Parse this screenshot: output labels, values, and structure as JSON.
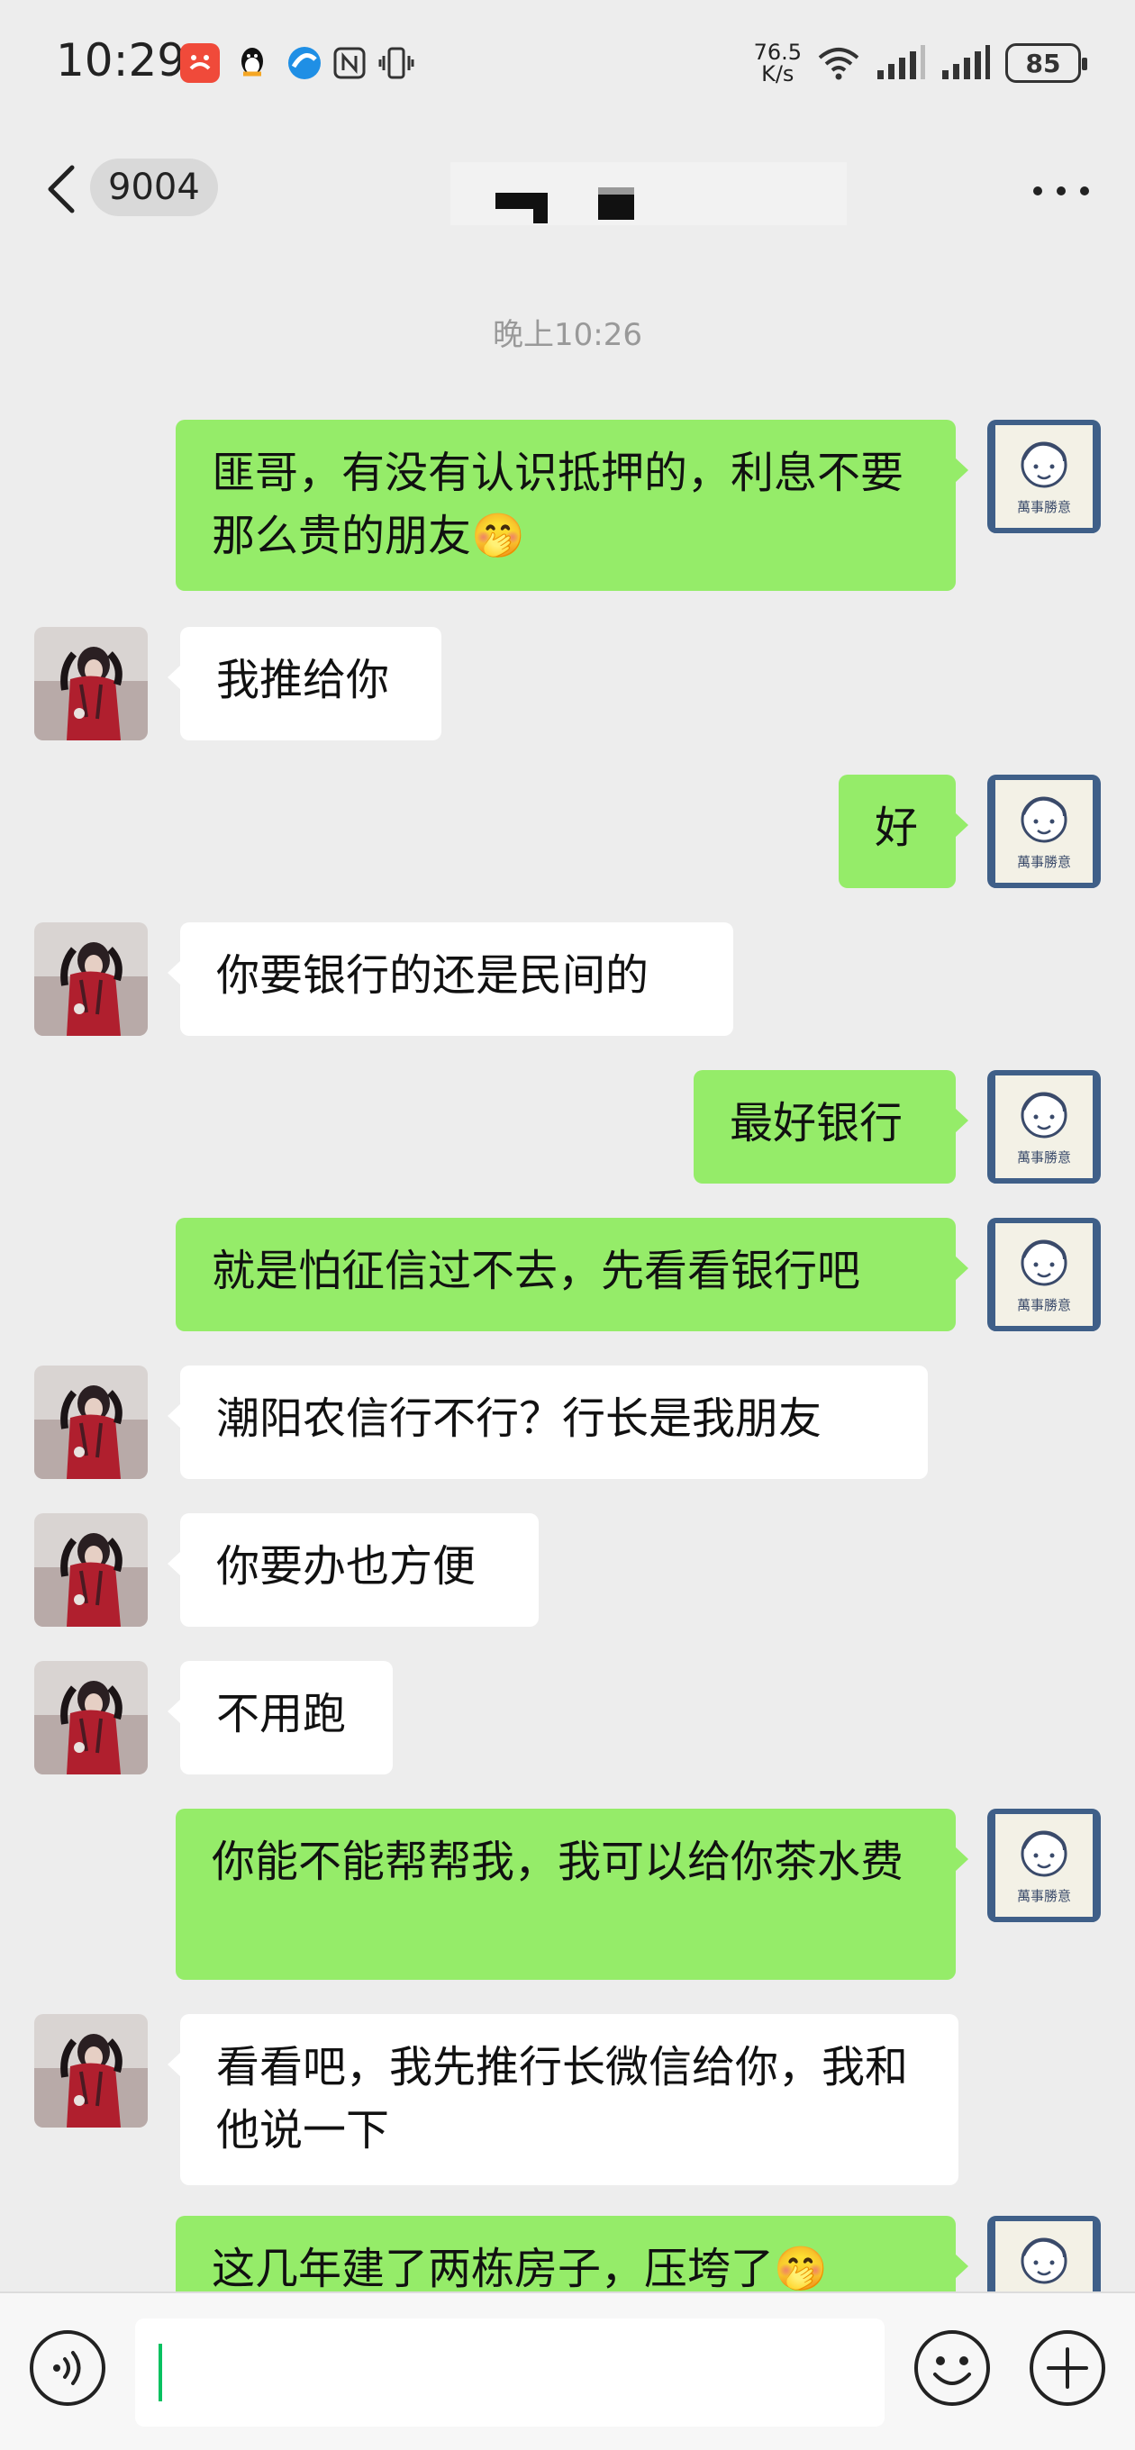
{
  "status_bar": {
    "time": "10:29",
    "net_speed_value": "76.5",
    "net_speed_unit": "K/s",
    "battery": "85",
    "icons": [
      "app-notification-icon",
      "qq-icon",
      "browser-icon",
      "nfc-icon",
      "vibrate-icon",
      "wifi-icon",
      "signal-icon",
      "signal-icon",
      "battery-icon"
    ]
  },
  "nav": {
    "back_icon": "chevron-left-icon",
    "unread_count": "9004",
    "more_icon": "more-icon"
  },
  "chat": {
    "timestamp": "晚上10:26",
    "messages": [
      {
        "side": "out",
        "text": "匪哥，有没有认识抵押的，利息不要那么贵的朋友",
        "emoji": "🤭"
      },
      {
        "side": "in",
        "text": "我推给你"
      },
      {
        "side": "out",
        "text": "好"
      },
      {
        "side": "in",
        "text": "你要银行的还是民间的"
      },
      {
        "side": "out",
        "text": "最好银行"
      },
      {
        "side": "out",
        "text": "就是怕征信过不去，先看看银行吧"
      },
      {
        "side": "in",
        "text": "潮阳农信行不行？行长是我朋友"
      },
      {
        "side": "in",
        "text": "你要办也方便"
      },
      {
        "side": "in",
        "text": "不用跑"
      },
      {
        "side": "out",
        "text": "你能不能帮帮我，我可以给你茶水费"
      },
      {
        "side": "in",
        "text": "看看吧，我先推行长微信给你，我和他说一下"
      },
      {
        "side": "out",
        "text": "这几年建了两栋房子，压垮了",
        "emoji": "🤭"
      }
    ],
    "my_avatar_caption": "萬事勝意"
  },
  "input_bar": {
    "voice_icon": "voice-icon",
    "emoji_icon": "emoji-icon",
    "plus_icon": "plus-icon"
  },
  "colors": {
    "background": "#ededed",
    "outgoing_bubble": "#95ec69",
    "incoming_bubble": "#ffffff",
    "caret": "#07c160"
  }
}
